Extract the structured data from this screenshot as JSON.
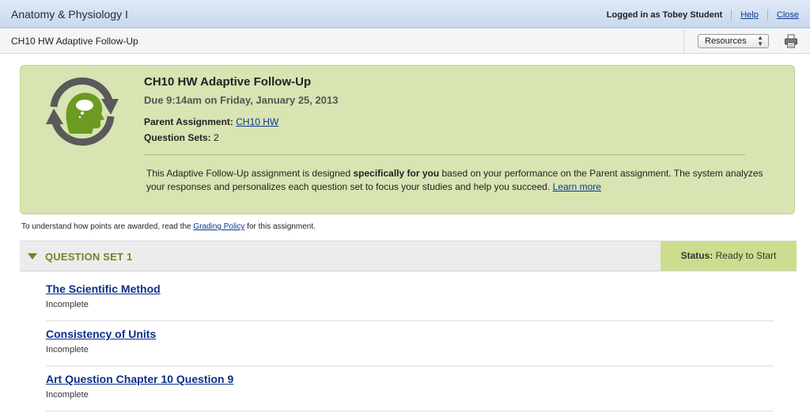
{
  "header": {
    "app_title": "Anatomy & Physiology I",
    "logged_in": "Logged in as Tobey Student",
    "help": "Help",
    "close": "Close"
  },
  "titlebar": {
    "page_title": "CH10 HW Adaptive Follow-Up",
    "resources_label": "Resources"
  },
  "assignment": {
    "title": "CH10 HW Adaptive Follow-Up",
    "due": "Due 9:14am on Friday, January 25, 2013",
    "parent_label": "Parent Assignment:",
    "parent_link": "CH10 HW",
    "sets_label": "Question Sets:",
    "sets_value": "2",
    "desc_part1": "This Adaptive Follow-Up assignment is designed ",
    "desc_bold": "specifically for you",
    "desc_part2": " based on your performance on the Parent assignment. The system analyzes your responses and personalizes each question set to focus your studies and help you succeed. ",
    "learn_more": "Learn more"
  },
  "grading": {
    "prefix": "To understand how points are awarded, read the ",
    "link": "Grading Policy",
    "suffix": " for this assignment."
  },
  "question_set": {
    "title": "QUESTION SET 1",
    "status_label": "Status:",
    "status_value": "Ready to Start",
    "items": [
      {
        "title": "The Scientific Method",
        "status": "Incomplete"
      },
      {
        "title": "Consistency of Units",
        "status": "Incomplete"
      },
      {
        "title": "Art Question Chapter 10 Question 9",
        "status": "Incomplete"
      }
    ]
  },
  "colors": {
    "panel_green": "#d8e4b2",
    "accent_green": "#6b8a1f",
    "link_blue": "#0b3a8c",
    "status_green": "#cddd8f"
  },
  "icons": [
    "adaptive-cycle-icon",
    "printer-icon",
    "collapse-triangle-icon",
    "select-arrows-icon"
  ]
}
